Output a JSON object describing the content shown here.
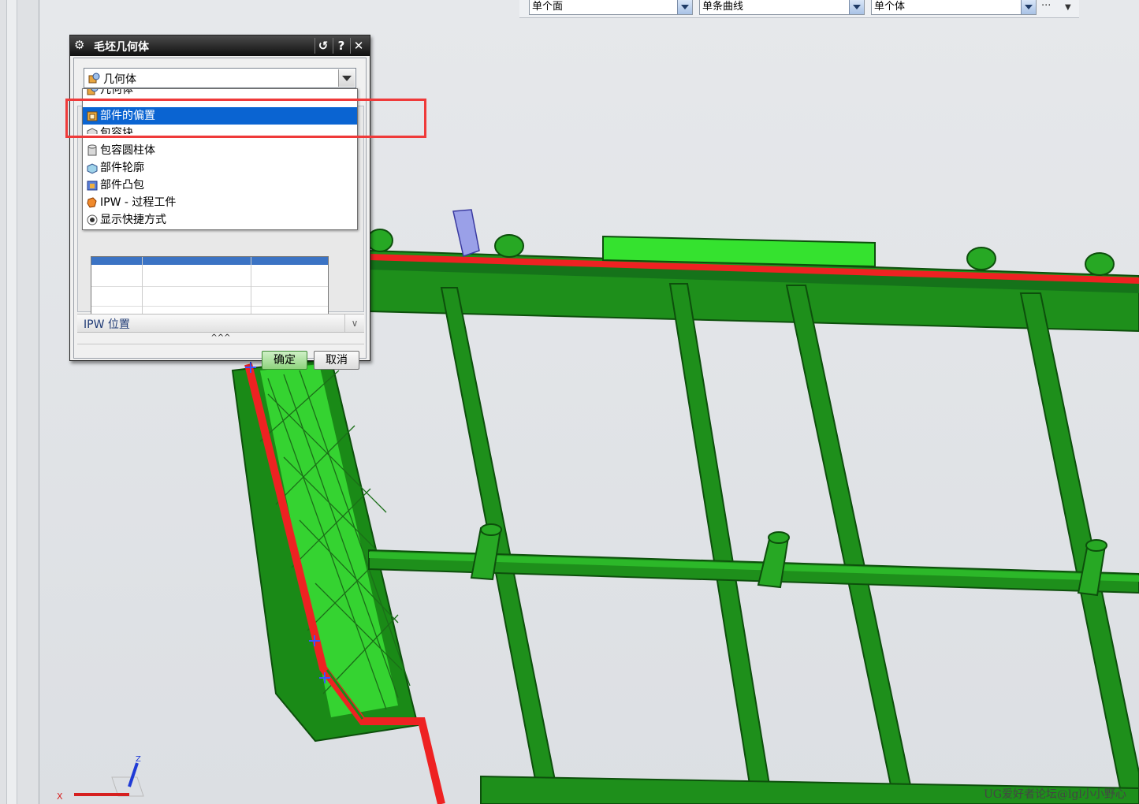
{
  "filter_bar": {
    "face_filter": "单个面",
    "curve_filter": "单条曲线",
    "body_filter": "单个体",
    "more_label": "···"
  },
  "dialog": {
    "title": "毛坯几何体",
    "type_label": "几何体",
    "section_ipw": "IPW 位置",
    "collapse_label": "^^^",
    "ok": "确定",
    "cancel": "取消"
  },
  "dropdown": {
    "options": [
      {
        "label": "几何体",
        "icon": "geometry-icon"
      },
      {
        "label": "部件的偏置",
        "icon": "part-offset-icon",
        "selected": true
      },
      {
        "label": "包容块",
        "icon": "bounding-block-icon"
      },
      {
        "label": "包容圆柱体",
        "icon": "bounding-cylinder-icon"
      },
      {
        "label": "部件轮廓",
        "icon": "part-outline-icon"
      },
      {
        "label": "部件凸包",
        "icon": "part-convex-hull-icon"
      },
      {
        "label": "IPW - 过程工件",
        "icon": "ipw-icon"
      },
      {
        "label": "显示快捷方式",
        "icon": "radio-icon"
      }
    ]
  },
  "triad": {
    "z": "Z",
    "x": "X"
  },
  "watermark": "UG爱好者论坛@lgl小小野心",
  "colors": {
    "model_green": "#1f9a1c",
    "highlight_red": "#ef3a3a",
    "select_blue": "#0a64d2"
  }
}
